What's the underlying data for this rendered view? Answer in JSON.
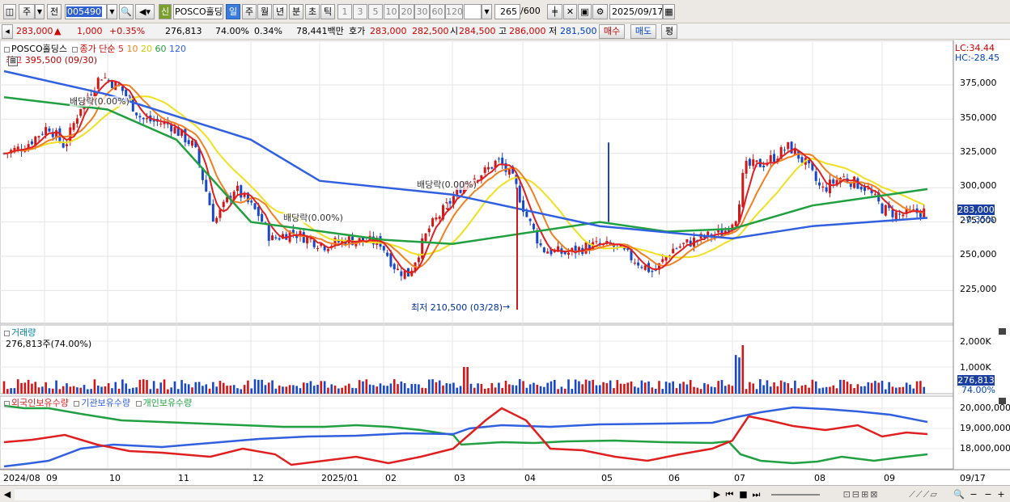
{
  "toolbar": {
    "period_main": "주",
    "prev_label": "전",
    "code": "005490",
    "sin_badge": "신",
    "stock_name": "POSCO홀딩스",
    "periods": [
      "일",
      "주",
      "월",
      "년",
      "분",
      "초",
      "틱"
    ],
    "selected_period": "일",
    "intervals": [
      "1",
      "3",
      "5",
      "10",
      "20",
      "30",
      "60",
      "120"
    ],
    "count": "265",
    "count_max": "/600",
    "date": "2025/09/17"
  },
  "quote": {
    "price": "283,000",
    "change": "1,000",
    "change_pct": "+0.35%",
    "volume": "276,813",
    "volume_ratio": "74.00%",
    "turnover_pct": "0.34%",
    "trade_amount": "78,441백만",
    "bid_label": "호가",
    "ask": "283,000",
    "bid": "282,500",
    "open_label": "시",
    "open": "284,500",
    "high_label": "고",
    "high": "286,000",
    "low_label": "저",
    "low": "281,500",
    "buy_button": "매수",
    "sell_button": "매도",
    "eval_button": "평"
  },
  "price_panel": {
    "stock": "POSCO홀딩스",
    "legend_prefix": "종가 단순",
    "ma": [
      {
        "period": "5",
        "color": "#e02020"
      },
      {
        "period": "10",
        "color": "#f08020"
      },
      {
        "period": "20",
        "color": "#f0e020"
      },
      {
        "period": "60",
        "color": "#20a040"
      },
      {
        "period": "120",
        "color": "#3060e0"
      }
    ],
    "high_marker": "최고 395,500 (09/30)",
    "low_marker": "최저 210,500 (03/28)",
    "dividend_label": "배당락(0.00%)",
    "lc": "LC:34.44",
    "hc": "HC:-28.45",
    "current_price": "283,000",
    "current_pct": "-0.35%",
    "y_ticks": [
      "375,000",
      "350,000",
      "325,000",
      "300,000",
      "275,000",
      "250,000",
      "225,000"
    ]
  },
  "volume_panel": {
    "title": "거래량",
    "value": "276,813주(74.00%)",
    "y_ticks": [
      "2,000K",
      "1,000K"
    ],
    "current": "276,813",
    "current_pct": "74.00%"
  },
  "holdings_panel": {
    "series": [
      {
        "name": "외국인보유수량",
        "color": "#e02020"
      },
      {
        "name": "기관보유수량",
        "color": "#3060e0"
      },
      {
        "name": "개인보유수량",
        "color": "#20a040"
      }
    ],
    "y_ticks": [
      "20,000,000",
      "19,000,000",
      "18,000,000"
    ]
  },
  "x_axis": {
    "labels": [
      "2024/08",
      "09",
      "10",
      "11",
      "12",
      "2025/01",
      "02",
      "03",
      "04",
      "05",
      "06",
      "07",
      "08",
      "09",
      "09/17"
    ]
  },
  "chart_data": {
    "type": "line",
    "title": "POSCO홀딩스",
    "x_range": [
      "2024/08",
      "2025/09/17"
    ],
    "ylim": [
      210000,
      400000
    ],
    "series": [
      {
        "name": "종가",
        "x": [
          "2024/08",
          "2024/09",
          "2024/10",
          "2024/11",
          "2024/12",
          "2025/01",
          "2025/02",
          "2025/03",
          "2025/04",
          "2025/05",
          "2025/06",
          "2025/07",
          "2025/08",
          "2025/09",
          "2025/09/17"
        ],
        "values": [
          325000,
          340000,
          380000,
          345000,
          270000,
          262000,
          245000,
          315000,
          270000,
          255000,
          255000,
          270000,
          310000,
          305000,
          283000
        ]
      },
      {
        "name": "120",
        "x": [
          "2024/08",
          "2024/10",
          "2024/12",
          "2025/01",
          "2025/03",
          "2025/05",
          "2025/07",
          "2025/08",
          "2025/09/17"
        ],
        "values": [
          385000,
          368000,
          335000,
          305000,
          295000,
          272000,
          263000,
          272000,
          278000
        ]
      },
      {
        "name": "60",
        "x": [
          "2024/08",
          "2024/10",
          "2024/11",
          "2024/12",
          "2025/02",
          "2025/03",
          "2025/05",
          "2025/06",
          "2025/07",
          "2025/08",
          "2025/09/17"
        ],
        "values": [
          366000,
          357000,
          335000,
          275000,
          262000,
          259000,
          275000,
          268000,
          270000,
          287000,
          299000
        ]
      }
    ],
    "markers": [
      {
        "label": "최고",
        "value": 395500,
        "date": "09/30"
      },
      {
        "label": "최저",
        "value": 210500,
        "date": "03/28"
      }
    ],
    "volume": {
      "unit": "K",
      "ylim": [
        0,
        2500
      ],
      "last": 276.813
    }
  }
}
